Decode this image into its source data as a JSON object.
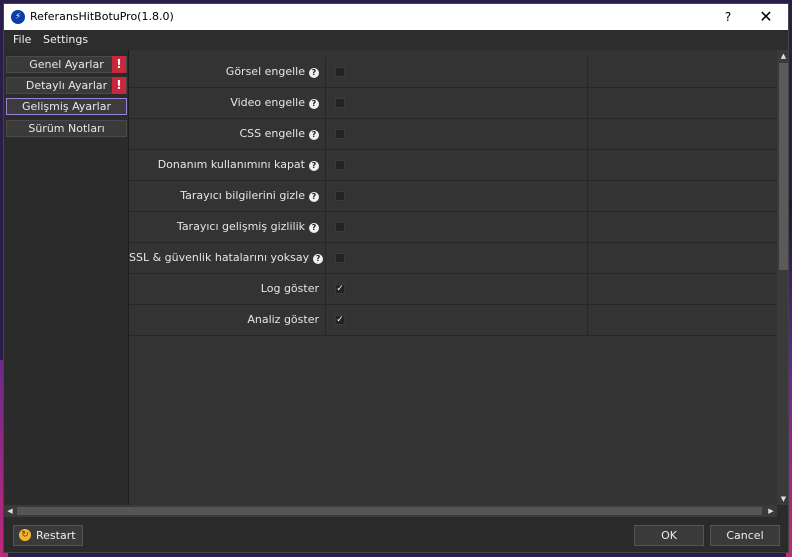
{
  "window": {
    "title": "ReferansHitBotuPro(1.8.0)",
    "help_label": "?",
    "close_label": "✕"
  },
  "menu": [
    {
      "label": "File"
    },
    {
      "label": "Settings"
    }
  ],
  "sidebar": {
    "items": [
      {
        "label": "Genel Ayarlar",
        "warning": "!"
      },
      {
        "label": "Detaylı Ayarlar",
        "warning": "!"
      },
      {
        "label": "Gelişmiş Ayarlar",
        "active": true
      },
      {
        "label": "Sürüm Notları"
      }
    ]
  },
  "settings": [
    {
      "label": "Görsel engelle",
      "checked": false
    },
    {
      "label": "Video engelle",
      "checked": false
    },
    {
      "label": "CSS engelle",
      "checked": false
    },
    {
      "label": "Donanım kullanımını kapat",
      "checked": false
    },
    {
      "label": "Tarayıcı bilgilerini gizle",
      "checked": false
    },
    {
      "label": "Tarayıcı gelişmiş gizlilik",
      "checked": false
    },
    {
      "label": "SSL & güvenlik hatalarını yoksay",
      "checked": false
    },
    {
      "label": "Log göster",
      "checked": true
    },
    {
      "label": "Analiz göster",
      "checked": true
    }
  ],
  "check_mark": "✓",
  "help_glyph": "?",
  "footer": {
    "restart_label": "Restart",
    "ok_label": "OK",
    "cancel_label": "Cancel"
  },
  "colors": {
    "warning": "#c7283c",
    "active_border": "#9a82d8",
    "restart_icon": "#f2b632"
  }
}
